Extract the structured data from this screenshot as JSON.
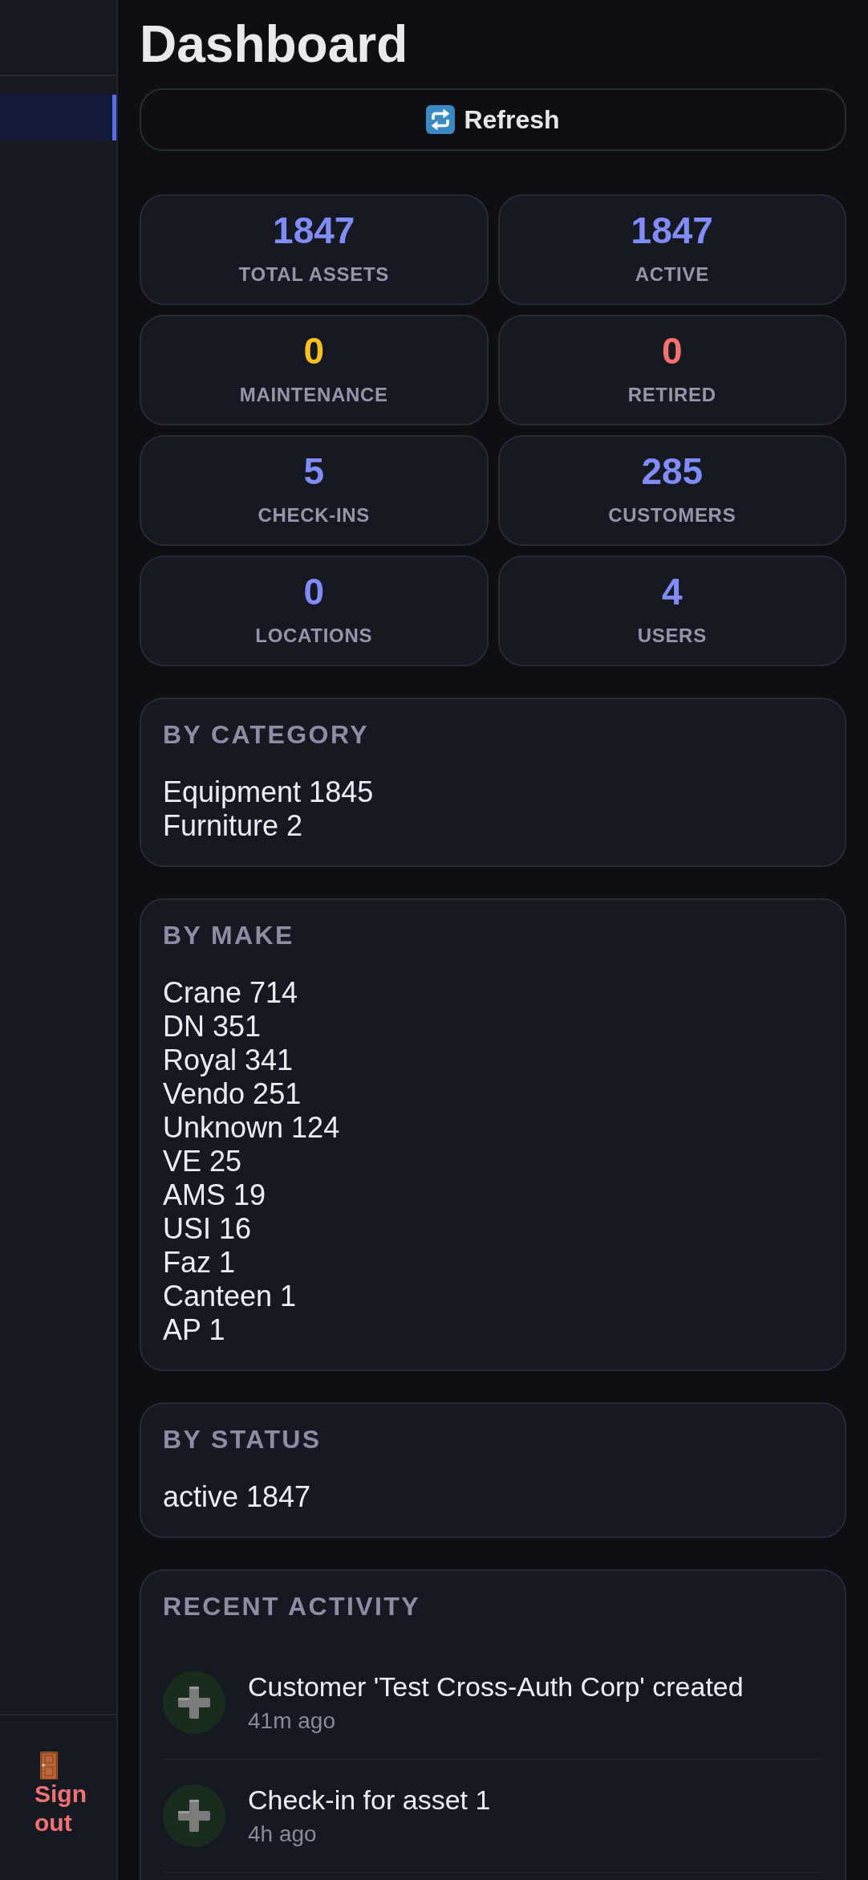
{
  "sidebar": {
    "items": [
      {
        "selected": true
      }
    ],
    "sign_out": {
      "label": "Sign out"
    }
  },
  "page": {
    "title": "Dashboard",
    "refresh_button": {
      "label": "Refresh"
    }
  },
  "stats": [
    {
      "value": "1847",
      "label": "TOTAL ASSETS",
      "color": "#818cf8"
    },
    {
      "value": "1847",
      "label": "ACTIVE",
      "color": "#818cf8"
    },
    {
      "value": "0",
      "label": "MAINTENANCE",
      "color": "#fbbf24"
    },
    {
      "value": "0",
      "label": "RETIRED",
      "color": "#f87171"
    },
    {
      "value": "5",
      "label": "CHECK-INS",
      "color": "#818cf8"
    },
    {
      "value": "285",
      "label": "CUSTOMERS",
      "color": "#818cf8"
    },
    {
      "value": "0",
      "label": "LOCATIONS",
      "color": "#818cf8"
    },
    {
      "value": "4",
      "label": "USERS",
      "color": "#818cf8"
    }
  ],
  "breakdowns": [
    {
      "title": "BY CATEGORY",
      "lines": [
        "Equipment 1845",
        "Furniture 2"
      ]
    },
    {
      "title": "BY MAKE",
      "lines": [
        "Crane 714",
        "DN 351",
        "Royal 341",
        "Vendo 251",
        "Unknown 124",
        "VE 25",
        "AMS 19",
        "USI 16",
        "Faz 1",
        "Canteen 1",
        "AP 1"
      ]
    },
    {
      "title": "BY STATUS",
      "lines": [
        "active 1847"
      ]
    }
  ],
  "recent_activity": {
    "title": "RECENT ACTIVITY",
    "items": [
      {
        "text": "Customer 'Test Cross-Auth Corp' created",
        "time": "41m ago"
      },
      {
        "text": "Check-in for asset 1",
        "time": "4h ago"
      }
    ]
  }
}
